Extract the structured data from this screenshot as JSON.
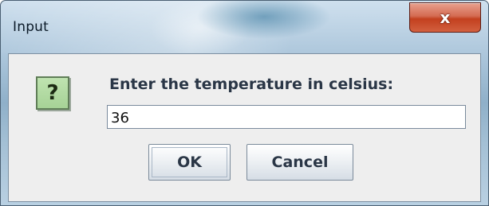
{
  "window": {
    "title": "Input",
    "close_glyph": "x"
  },
  "dialog": {
    "icon": "question-icon",
    "icon_glyph": "?",
    "prompt": "Enter the temperature in celsius:",
    "input": {
      "value": "36",
      "placeholder": ""
    },
    "buttons": {
      "ok_label": "OK",
      "cancel_label": "Cancel"
    }
  },
  "colors": {
    "close_button": "#c94a2e",
    "icon_background": "#a6d296",
    "dialog_background": "#eeeeee"
  }
}
